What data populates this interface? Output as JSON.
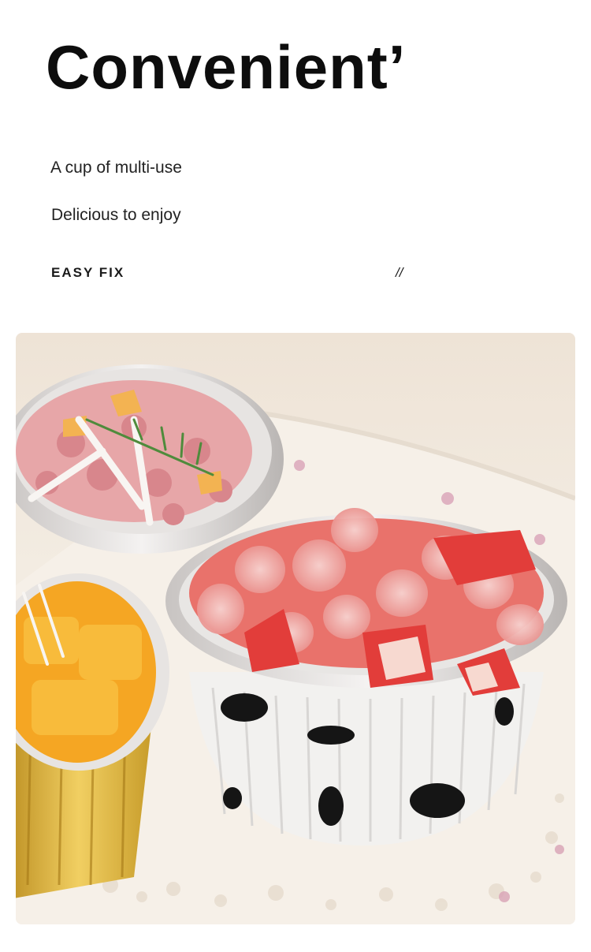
{
  "heading": {
    "title": "Convenient’"
  },
  "intro": {
    "line1": "A cup of multi-use",
    "line2": "Delicious to enjoy"
  },
  "tagline": {
    "label": "EASY FIX",
    "mark": "//"
  },
  "photo": {
    "subject": "foil-baking-cups-with-dessert"
  }
}
